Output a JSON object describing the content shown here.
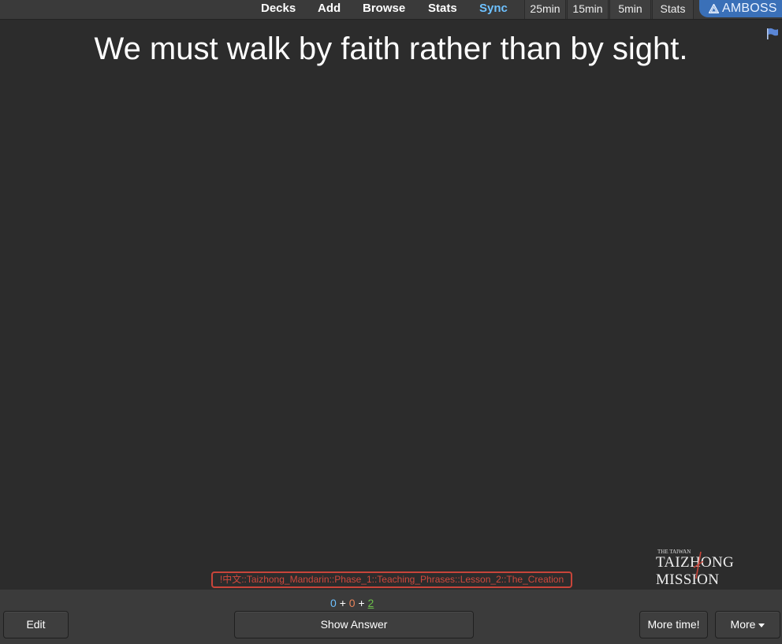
{
  "toolbar": {
    "nav": [
      "Decks",
      "Add",
      "Browse",
      "Stats",
      "Sync"
    ],
    "timers": [
      "25min",
      "15min",
      "5min"
    ],
    "stats_button": "Stats",
    "amboss_label": "AMBOSS"
  },
  "card": {
    "question": "We must walk by faith rather than by sight.",
    "deck_tag": "!中文::Taizhong_Mandarin::Phase_1::Teaching_Phrases::Lesson_2::The_Creation",
    "logo": {
      "small": "THE TAIWAN",
      "big": "TAIZHONG MISSION"
    }
  },
  "bottom": {
    "counts": {
      "new": "0",
      "learning": "0",
      "review": "2",
      "sep": "+"
    },
    "edit_label": "Edit",
    "show_answer_label": "Show Answer",
    "more_time_label": "More time!",
    "more_label": "More"
  },
  "colors": {
    "background": "#2c2c2c",
    "sync_blue": "#6ec1ff",
    "amboss_blue": "#3a70b8",
    "tag_red": "#d0483c",
    "review_green": "#6cc04a",
    "learn_orange": "#e8845a"
  },
  "icons": [
    "flag-icon",
    "amboss-logo-icon",
    "caret-down-icon"
  ]
}
